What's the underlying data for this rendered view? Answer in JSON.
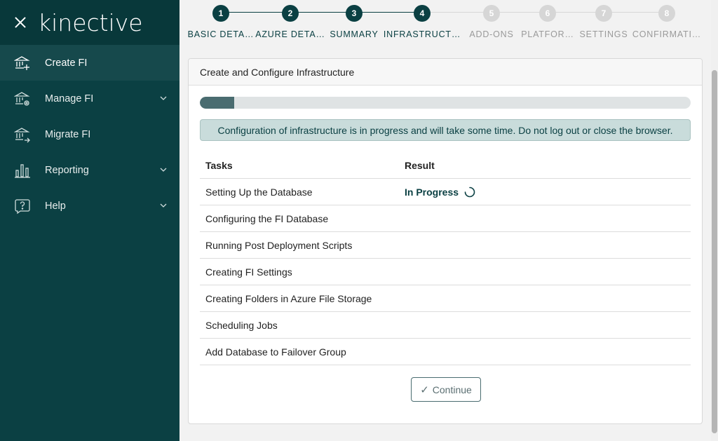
{
  "sidebar": {
    "logo": "kinective",
    "items": [
      {
        "label": "Create FI",
        "icon": "bank-plus-icon",
        "active": true
      },
      {
        "label": "Manage FI",
        "icon": "bank-gear-icon",
        "expandable": true
      },
      {
        "label": "Migrate FI",
        "icon": "bank-arrow-icon"
      },
      {
        "label": "Reporting",
        "icon": "bar-chart-icon",
        "expandable": true
      },
      {
        "label": "Help",
        "icon": "question-icon",
        "expandable": true
      }
    ]
  },
  "stepper": {
    "steps": [
      {
        "number": "1",
        "label": "BASIC DETA…",
        "state": "done"
      },
      {
        "number": "2",
        "label": "AZURE DETA…",
        "state": "done"
      },
      {
        "number": "3",
        "label": "SUMMARY",
        "state": "done"
      },
      {
        "number": "4",
        "label": "INFRASTRUCT…",
        "state": "current"
      },
      {
        "number": "5",
        "label": "ADD-ONS",
        "state": "todo"
      },
      {
        "number": "6",
        "label": "PLATFOR…",
        "state": "todo"
      },
      {
        "number": "7",
        "label": "SETTINGS",
        "state": "todo"
      },
      {
        "number": "8",
        "label": "CONFIRMATI…",
        "state": "todo"
      }
    ]
  },
  "card": {
    "title": "Create and Configure Infrastructure",
    "progress_fraction": 0.07,
    "alert": "Configuration of infrastructure is in progress and will take some time. Do not log out or close the browser.",
    "table": {
      "headers": [
        "Tasks",
        "Result"
      ],
      "rows": [
        {
          "task": "Setting Up the Database",
          "result": "In Progress"
        },
        {
          "task": "Configuring the FI Database",
          "result": ""
        },
        {
          "task": "Running Post Deployment Scripts",
          "result": ""
        },
        {
          "task": "Creating FI Settings",
          "result": ""
        },
        {
          "task": "Creating Folders in Azure File Storage",
          "result": ""
        },
        {
          "task": "Scheduling Jobs",
          "result": ""
        },
        {
          "task": "Add Database to Failover Group",
          "result": ""
        }
      ]
    },
    "continue_label": "Continue"
  },
  "colors": {
    "sidebar_bg": "#0b4043",
    "accent": "#0b4043",
    "inactive_step": "#d6d6d6"
  }
}
